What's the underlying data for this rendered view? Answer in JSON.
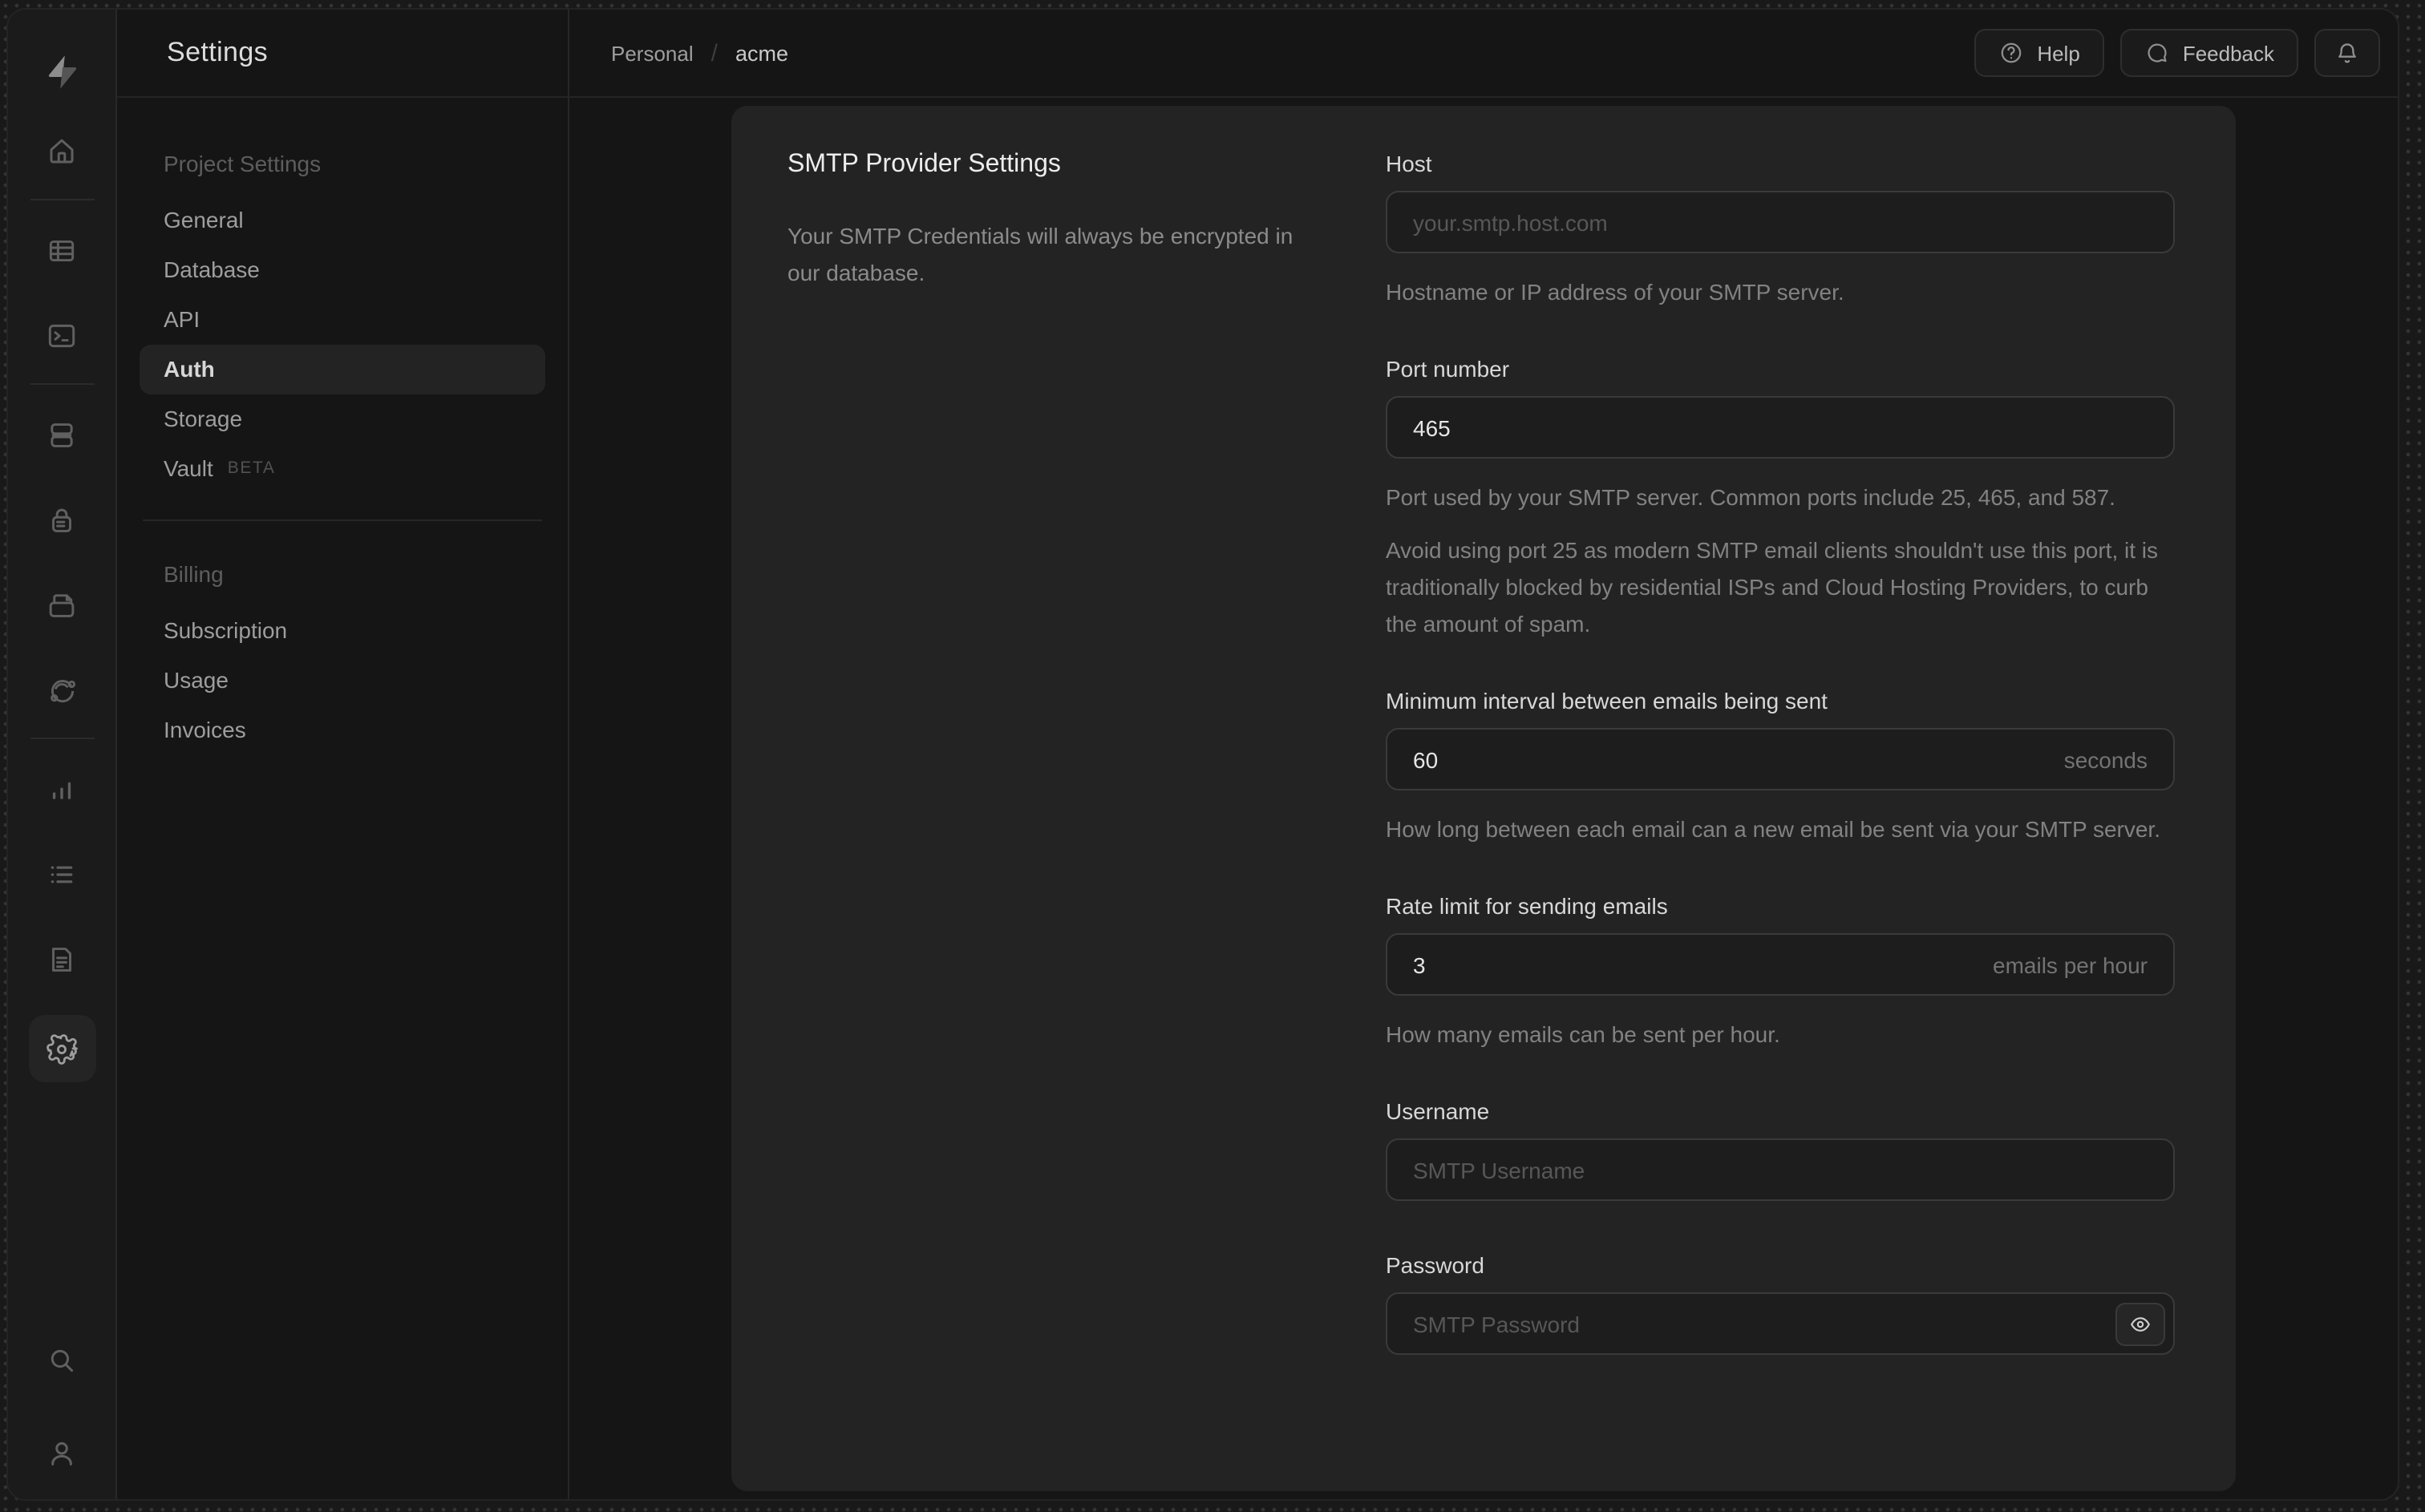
{
  "app": {
    "name": "supabase"
  },
  "rail": {
    "icons": [
      "supabase-logo",
      "home",
      "table-editor",
      "sql-editor",
      "database",
      "auth",
      "storage",
      "edge-functions",
      "reports",
      "logs",
      "docs",
      "settings",
      "search",
      "account"
    ],
    "active_icon": "settings"
  },
  "sidebar": {
    "title": "Settings",
    "sections": [
      {
        "label": "Project Settings",
        "items": [
          {
            "label": "General"
          },
          {
            "label": "Database"
          },
          {
            "label": "API"
          },
          {
            "label": "Auth",
            "active": true
          },
          {
            "label": "Storage"
          },
          {
            "label": "Vault",
            "badge": "BETA"
          }
        ]
      },
      {
        "label": "Billing",
        "items": [
          {
            "label": "Subscription"
          },
          {
            "label": "Usage"
          },
          {
            "label": "Invoices"
          }
        ]
      }
    ]
  },
  "header": {
    "breadcrumb": {
      "org": "Personal",
      "separator": "/",
      "project": "acme"
    },
    "help_label": "Help",
    "feedback_label": "Feedback"
  },
  "panel": {
    "title": "SMTP Provider Settings",
    "description": "Your SMTP Credentials will always be encrypted in our database.",
    "fields": {
      "host": {
        "label": "Host",
        "placeholder": "your.smtp.host.com",
        "helper": "Hostname or IP address of your SMTP server."
      },
      "port": {
        "label": "Port number",
        "value": "465",
        "helper": "Port used by your SMTP server. Common ports include 25, 465, and 587.",
        "note": "Avoid using port 25 as modern SMTP email clients shouldn't use this port, it is traditionally blocked by residential ISPs and Cloud Hosting Providers, to curb the amount of spam."
      },
      "interval": {
        "label": "Minimum interval between emails being sent",
        "value": "60",
        "suffix": "seconds",
        "helper": "How long between each email can a new email be sent via your SMTP server."
      },
      "rate": {
        "label": "Rate limit for sending emails",
        "value": "3",
        "suffix": "emails per hour",
        "helper": "How many emails can be sent per hour."
      },
      "username": {
        "label": "Username",
        "placeholder": "SMTP Username"
      },
      "password": {
        "label": "Password",
        "placeholder": "SMTP Password"
      }
    }
  },
  "colors": {
    "panel_bg": "#232323",
    "window_bg": "#141414",
    "rail_bg": "#1b1b1b",
    "input_bg": "#1d1d1d",
    "input_border": "#3a3a3a",
    "text_primary": "#ededed",
    "text_muted": "#828282",
    "active_item_bg": "#232323"
  }
}
